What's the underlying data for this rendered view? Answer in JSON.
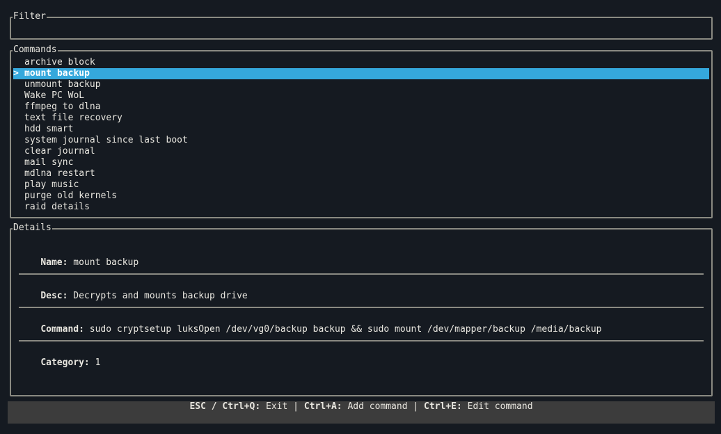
{
  "filter": {
    "title": "Filter",
    "value": "",
    "placeholder": ""
  },
  "commands": {
    "title": "Commands",
    "selected_marker": ">",
    "selected_index": 1,
    "items": [
      "archive block",
      "mount backup",
      "unmount backup",
      "Wake PC WoL",
      "ffmpeg to dlna",
      "text file recovery",
      "hdd smart",
      "system journal since last boot",
      "clear journal",
      "mail sync",
      "mdlna restart",
      "play music",
      "purge old kernels",
      "raid details"
    ]
  },
  "details": {
    "title": "Details",
    "name_label": "Name:",
    "name_value": "mount backup",
    "desc_label": "Desc:",
    "desc_value": "Decrypts and mounts backup drive",
    "command_label": "Command:",
    "command_value": "sudo cryptsetup luksOpen /dev/vg0/backup backup && sudo mount /dev/mapper/backup /media/backup",
    "category_label": "Category:",
    "category_value": "1"
  },
  "statusbar": {
    "exit_key": "ESC / Ctrl+Q:",
    "exit_label": "Exit",
    "add_key": "Ctrl+A:",
    "add_label": "Add command",
    "edit_key": "Ctrl+E:",
    "edit_label": "Edit command",
    "separator": "|"
  },
  "colors": {
    "accent": "#35a8dc",
    "background": "#151a21",
    "border": "#8a8a82",
    "statusbar": "#3c3c3c"
  }
}
